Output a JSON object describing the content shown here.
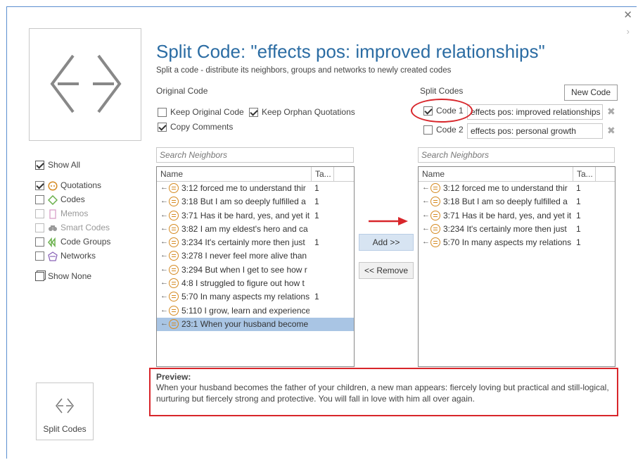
{
  "header": {
    "title": "Split Code: \"effects pos: improved relationships\"",
    "subtitle": "Split a code - distribute its neighbors, groups and networks to newly created codes"
  },
  "original": {
    "section_label": "Original Code",
    "keep_original_label": "Keep Original Code",
    "keep_original_checked": false,
    "keep_orphan_label": "Keep Orphan Quotations",
    "keep_orphan_checked": true,
    "copy_comments_label": "Copy Comments",
    "copy_comments_checked": true,
    "search_placeholder": "Search Neighbors",
    "col_name": "Name",
    "col_ta": "Ta...",
    "rows": [
      {
        "name": "3:12 forced me to understand thir",
        "count": "1"
      },
      {
        "name": "3:18 But I am so deeply fulfilled a",
        "count": "1"
      },
      {
        "name": "3:71 Has it be hard, yes, and yet it",
        "count": "1"
      },
      {
        "name": "3:82 I am my eldest's hero and ca",
        "count": ""
      },
      {
        "name": "3:234 It's certainly more then just",
        "count": "1"
      },
      {
        "name": "3:278 I never feel more alive than",
        "count": ""
      },
      {
        "name": "3:294 But when I get to see how r",
        "count": ""
      },
      {
        "name": "4:8 I struggled to figure out how t",
        "count": ""
      },
      {
        "name": "5:70 In many aspects my relations",
        "count": "1"
      },
      {
        "name": "5:110 I grow, learn and experience",
        "count": ""
      },
      {
        "name": "23:1 When your husband become",
        "count": ""
      }
    ],
    "selected_index": 10
  },
  "split": {
    "section_label": "Split Codes",
    "new_code_label": "New Code",
    "codes": [
      {
        "label": "Code 1",
        "checked": true,
        "name": "effects pos: improved relationships"
      },
      {
        "label": "Code 2",
        "checked": false,
        "name": "effects pos: personal growth"
      }
    ],
    "search_placeholder": "Search Neighbors",
    "col_name": "Name",
    "col_ta": "Ta...",
    "rows": [
      {
        "name": "3:12 forced me to understand thir",
        "count": "1"
      },
      {
        "name": "3:18 But I am so deeply fulfilled a",
        "count": "1"
      },
      {
        "name": "3:71 Has it be hard, yes, and yet it",
        "count": "1"
      },
      {
        "name": "3:234 It's certainly more then just",
        "count": "1"
      },
      {
        "name": "5:70 In many aspects my relations",
        "count": "1"
      }
    ]
  },
  "buttons": {
    "add": "Add >>",
    "remove": "<< Remove",
    "split": "Split Codes"
  },
  "sidebar": {
    "show_all": "Show All",
    "show_none": "Show None",
    "items": [
      {
        "label": "Quotations",
        "checked": true,
        "icon": "quotation-icon",
        "enabled": true
      },
      {
        "label": "Codes",
        "checked": false,
        "icon": "code-icon",
        "enabled": true
      },
      {
        "label": "Memos",
        "checked": false,
        "icon": "memo-icon",
        "enabled": false
      },
      {
        "label": "Smart Codes",
        "checked": false,
        "icon": "smart-code-icon",
        "enabled": false
      },
      {
        "label": "Code Groups",
        "checked": false,
        "icon": "code-group-icon",
        "enabled": true
      },
      {
        "label": "Networks",
        "checked": false,
        "icon": "network-icon",
        "enabled": true
      }
    ]
  },
  "preview": {
    "title": "Preview:",
    "text": "When your husband becomes the father of your children, a new man appears: fiercely loving but practical and still-logical, nurturing but fiercely strong and protective. You will fall in love with him all over again."
  },
  "colors": {
    "title_blue": "#2b6ca3",
    "highlight_red": "#d8262b",
    "selection_blue": "#a9c5e4",
    "quotation_orange": "#d58a22"
  }
}
